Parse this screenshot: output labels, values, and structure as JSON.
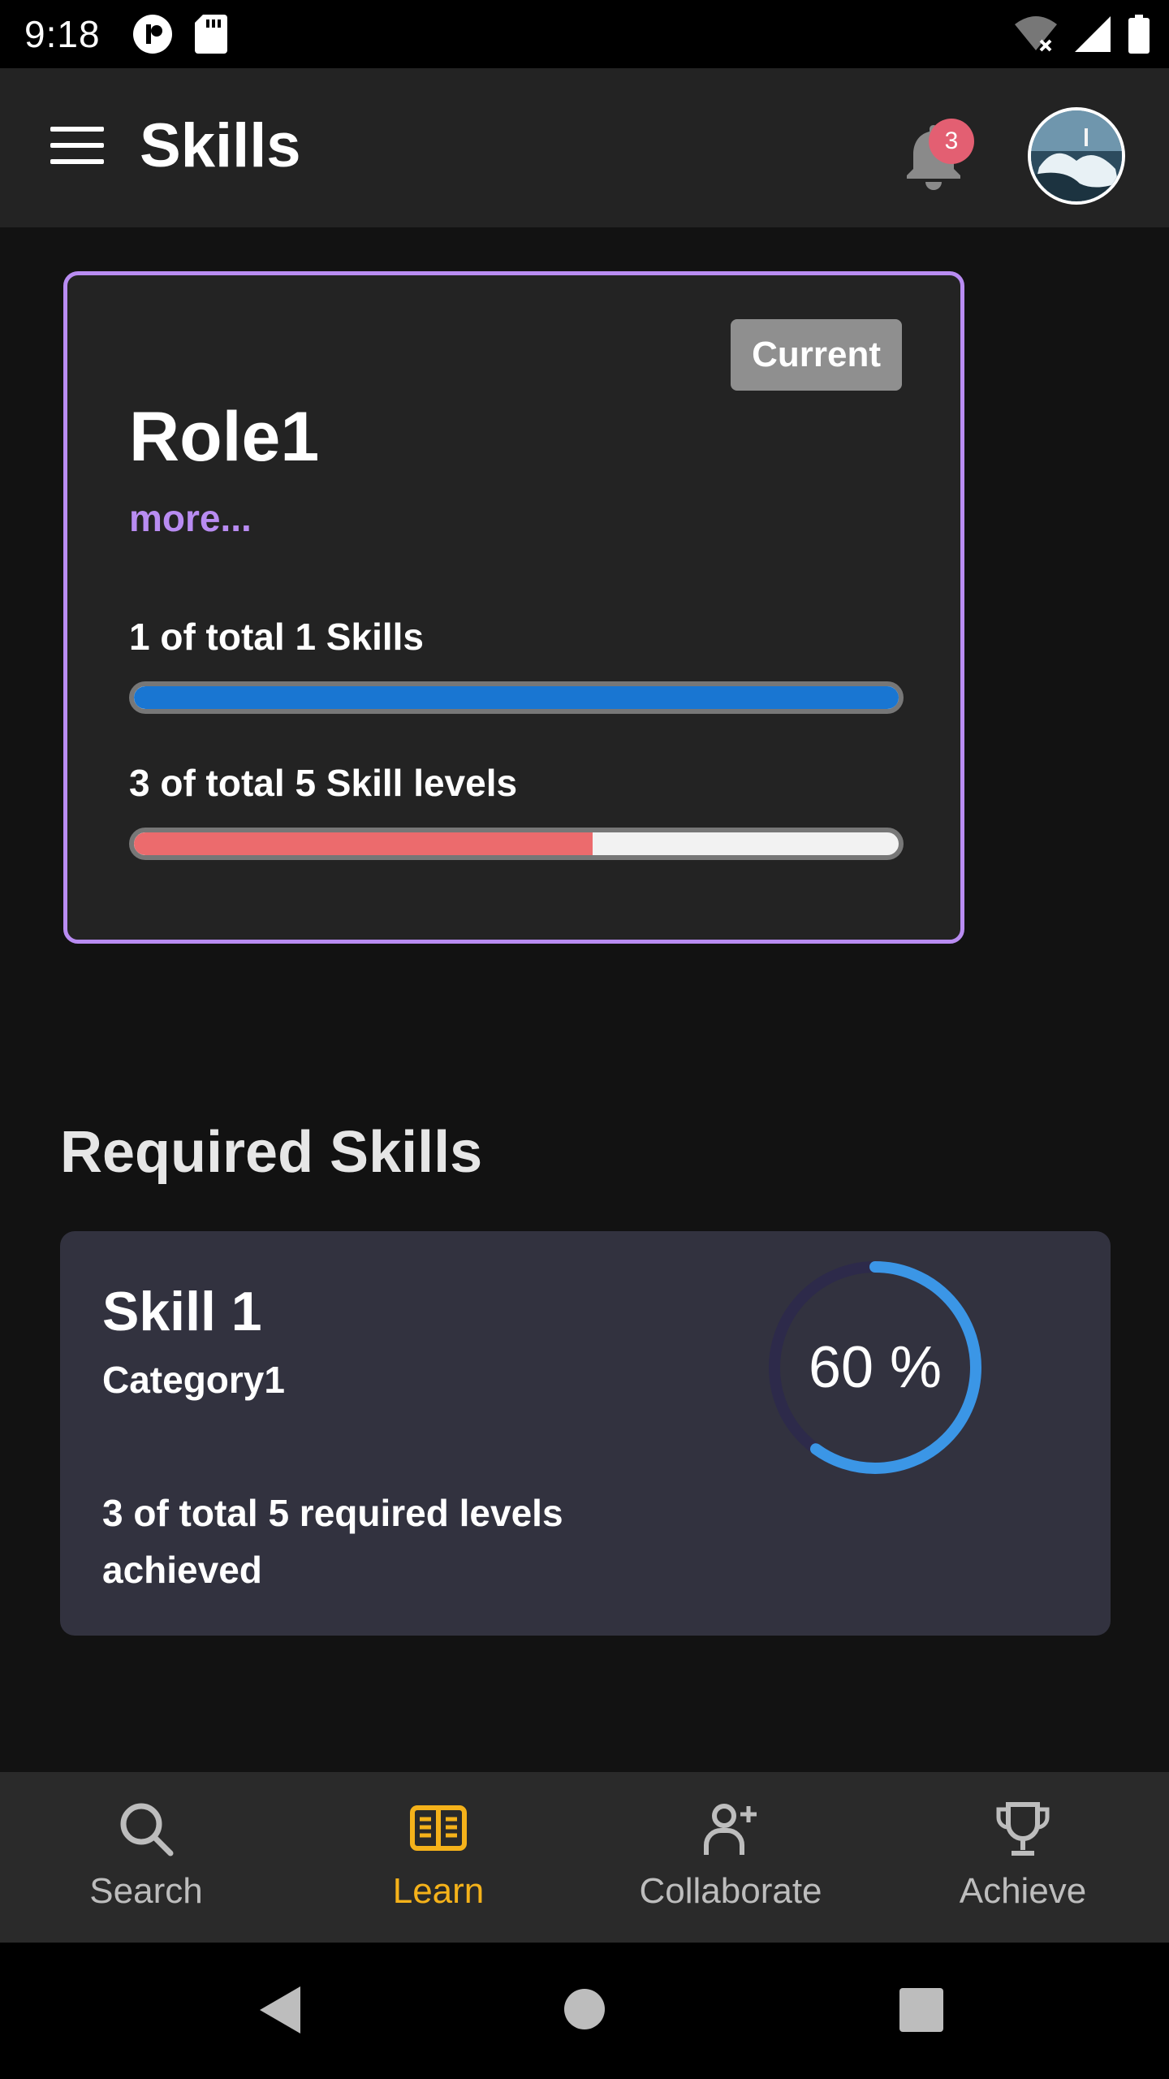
{
  "status_bar": {
    "time": "9:18"
  },
  "app_bar": {
    "title": "Skills",
    "notification_count": "3"
  },
  "role_card": {
    "badge": "Current",
    "title": "Role1",
    "more_link": "more...",
    "skills_progress": {
      "label": "1 of total 1 Skills",
      "value": 1,
      "total": 1,
      "color": "#1976d2"
    },
    "levels_progress": {
      "label": "3 of total 5 Skill levels",
      "value": 3,
      "total": 5,
      "color": "#ec6b6d"
    },
    "border_color": "#b98cf2"
  },
  "required_skills": {
    "title": "Required Skills",
    "items": [
      {
        "name": "Skill 1",
        "category": "Category1",
        "levels_text": "3 of total 5 required levels achieved",
        "percent_label": "60 %",
        "percent": 60,
        "ring_color": "#3b96e6"
      }
    ]
  },
  "bottom_nav": {
    "items": [
      {
        "label": "Search",
        "icon": "search-icon",
        "active": false
      },
      {
        "label": "Learn",
        "icon": "book-icon",
        "active": true
      },
      {
        "label": "Collaborate",
        "icon": "person-add-icon",
        "active": false
      },
      {
        "label": "Achieve",
        "icon": "trophy-icon",
        "active": false
      }
    ],
    "active_color": "#f5b21a"
  }
}
